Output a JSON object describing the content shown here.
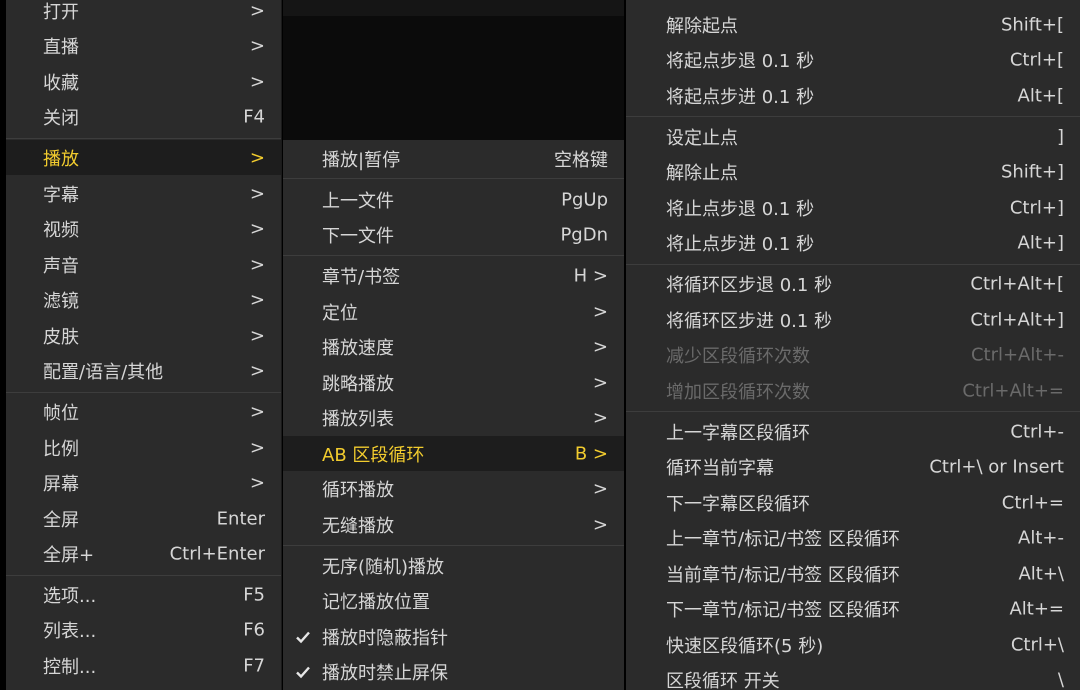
{
  "main_menu": {
    "items": [
      {
        "label": "打开",
        "shortcut": ">"
      },
      {
        "label": "直播",
        "shortcut": ">"
      },
      {
        "label": "收藏",
        "shortcut": ">"
      },
      {
        "label": "关闭",
        "shortcut": "F4"
      },
      {
        "label": "播放",
        "shortcut": ">"
      },
      {
        "label": "字幕",
        "shortcut": ">"
      },
      {
        "label": "视频",
        "shortcut": ">"
      },
      {
        "label": "声音",
        "shortcut": ">"
      },
      {
        "label": "滤镜",
        "shortcut": ">"
      },
      {
        "label": "皮肤",
        "shortcut": ">"
      },
      {
        "label": "配置/语言/其他",
        "shortcut": ">"
      },
      {
        "label": "帧位",
        "shortcut": ">"
      },
      {
        "label": "比例",
        "shortcut": ">"
      },
      {
        "label": "屏幕",
        "shortcut": ">"
      },
      {
        "label": "全屏",
        "shortcut": "Enter"
      },
      {
        "label": "全屏+",
        "shortcut": "Ctrl+Enter"
      },
      {
        "label": "选项...",
        "shortcut": "F5"
      },
      {
        "label": "列表...",
        "shortcut": "F6"
      },
      {
        "label": "控制...",
        "shortcut": "F7"
      }
    ]
  },
  "play_menu": {
    "items": [
      {
        "label": "播放|暂停",
        "shortcut": "空格键"
      },
      {
        "label": "上一文件",
        "shortcut": "PgUp"
      },
      {
        "label": "下一文件",
        "shortcut": "PgDn"
      },
      {
        "label": "章节/书签",
        "shortcut": "H >"
      },
      {
        "label": "定位",
        "shortcut": ">"
      },
      {
        "label": "播放速度",
        "shortcut": ">"
      },
      {
        "label": "跳略播放",
        "shortcut": ">"
      },
      {
        "label": "播放列表",
        "shortcut": ">"
      },
      {
        "label": "AB 区段循环",
        "shortcut": "B >"
      },
      {
        "label": "循环播放",
        "shortcut": ">"
      },
      {
        "label": "无缝播放",
        "shortcut": ">"
      },
      {
        "label": "无序(随机)播放",
        "shortcut": ""
      },
      {
        "label": "记忆播放位置",
        "shortcut": ""
      },
      {
        "label": "播放时隐蔽指针",
        "shortcut": "",
        "checked": true
      },
      {
        "label": "播放时禁止屏保",
        "shortcut": "",
        "checked": true
      }
    ]
  },
  "ab_loop_menu": {
    "items": [
      {
        "label": "解除起点",
        "shortcut": "Shift+["
      },
      {
        "label": "将起点步退 0.1 秒",
        "shortcut": "Ctrl+["
      },
      {
        "label": "将起点步进 0.1 秒",
        "shortcut": "Alt+["
      },
      {
        "label": "设定止点",
        "shortcut": "]"
      },
      {
        "label": "解除止点",
        "shortcut": "Shift+]"
      },
      {
        "label": "将止点步退 0.1 秒",
        "shortcut": "Ctrl+]"
      },
      {
        "label": "将止点步进 0.1 秒",
        "shortcut": "Alt+]"
      },
      {
        "label": "将循环区步退 0.1 秒",
        "shortcut": "Ctrl+Alt+["
      },
      {
        "label": "将循环区步进 0.1 秒",
        "shortcut": "Ctrl+Alt+]"
      },
      {
        "label": "减少区段循环次数",
        "shortcut": "Ctrl+Alt+-"
      },
      {
        "label": "增加区段循环次数",
        "shortcut": "Ctrl+Alt+="
      },
      {
        "label": "上一字幕区段循环",
        "shortcut": "Ctrl+-"
      },
      {
        "label": "循环当前字幕",
        "shortcut": "Ctrl+\\ or Insert"
      },
      {
        "label": "下一字幕区段循环",
        "shortcut": "Ctrl+="
      },
      {
        "label": "上一章节/标记/书签 区段循环",
        "shortcut": "Alt+-"
      },
      {
        "label": "当前章节/标记/书签 区段循环",
        "shortcut": "Alt+\\"
      },
      {
        "label": "下一章节/标记/书签 区段循环",
        "shortcut": "Alt+="
      },
      {
        "label": "快速区段循环(5 秒)",
        "shortcut": "Ctrl+\\"
      },
      {
        "label": "区段循环 开关",
        "shortcut": "\\"
      }
    ]
  },
  "colors": {
    "menu_bg": "#2b2b2b",
    "highlight_bg": "#1d1d1d",
    "highlight_text": "#f2cc2e",
    "text": "#d6d6d6",
    "disabled_text": "#6a6a6a"
  }
}
